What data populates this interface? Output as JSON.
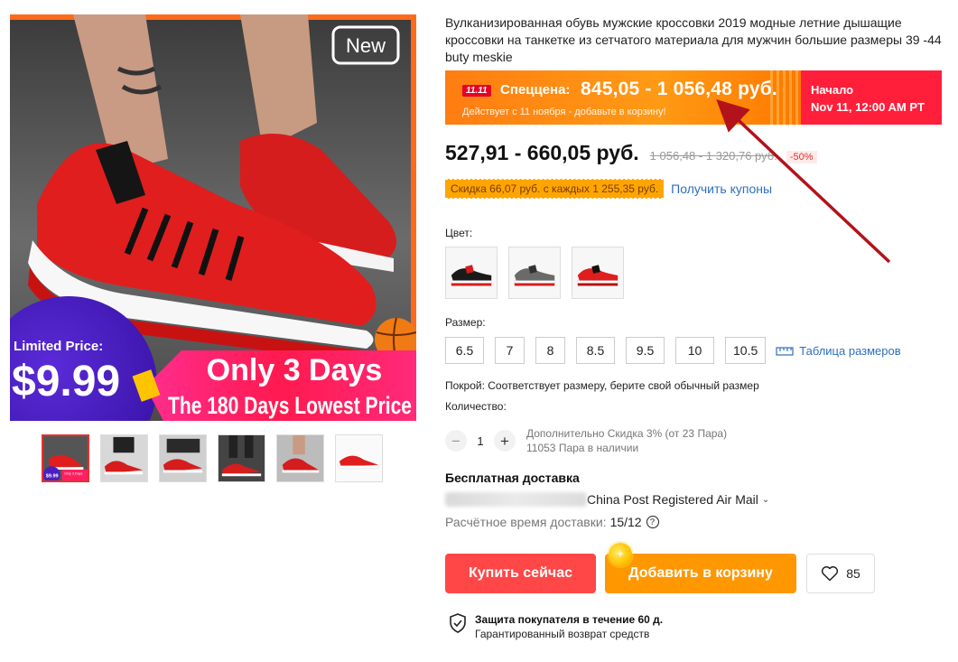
{
  "gallery": {
    "main_image": {
      "badge_new": "New",
      "limited_label": "Limited Price:",
      "limited_price": "$9.99",
      "banner_line1": "Only 3 Days",
      "banner_line2": "The 180 Days Lowest Price"
    },
    "thumbnails": [
      {
        "name": "thumbnail-1",
        "active": true,
        "mini_text": "Only 3 Days",
        "mini_price": "$9.99"
      },
      {
        "name": "thumbnail-2",
        "active": false
      },
      {
        "name": "thumbnail-3",
        "active": false
      },
      {
        "name": "thumbnail-4",
        "active": false
      },
      {
        "name": "thumbnail-5",
        "active": false
      },
      {
        "name": "thumbnail-6",
        "active": false
      }
    ]
  },
  "product": {
    "title": "Вулканизированная обувь мужские кроссовки 2019 модные летние дышащие кроссовки на танкетке из сетчатого материала для мужчин большие размеры 39 -44 buty meskie"
  },
  "promo": {
    "badge": "11.11",
    "label": "Спеццена:",
    "price": "845,05 - 1 056,48 руб.",
    "subtitle": "Действует с 11 ноября - добавьте в корзину!",
    "start_label": "Начало",
    "start_time": "Nov 11, 12:00 AM PT"
  },
  "price": {
    "current": "527,91 - 660,05 руб.",
    "original": "1 056,48 - 1 320,76 руб.",
    "discount": "-50%"
  },
  "coupon": {
    "text": "Скидка 66,07 руб. с каждых 1 255,35 руб.",
    "link": "Получить купоны"
  },
  "color": {
    "label": "Цвет:",
    "options": [
      "black",
      "grey",
      "red"
    ]
  },
  "size": {
    "label": "Размер:",
    "options": [
      "6.5",
      "7",
      "8",
      "8.5",
      "9.5",
      "10",
      "10.5"
    ],
    "chart_link": "Таблица размеров"
  },
  "fit_text": "Покрой: Соответствует размеру, берите свой обычный размер",
  "quantity": {
    "label": "Количество:",
    "minus": "−",
    "value": "1",
    "plus": "+",
    "extra_discount": "Дополнительно Скидка 3% (от 23 Пара)",
    "stock": "11053 Пара в наличии"
  },
  "shipping": {
    "title": "Бесплатная доставка",
    "method": "China Post Registered Air Mail",
    "eta_label": "Расчётное время доставки:",
    "eta_value": "15/12"
  },
  "buttons": {
    "buy": "Купить сейчас",
    "cart": "Добавить в корзину",
    "wishlist_count": "85"
  },
  "protection": {
    "title": "Защита покупателя в течение 60 д.",
    "subtitle": "Гарантированный возврат средств"
  },
  "colors": {
    "accent_red": "#ff4747",
    "accent_orange": "#ff9800",
    "link_blue": "#2d6fbf",
    "arrow_red": "#b3121b"
  }
}
